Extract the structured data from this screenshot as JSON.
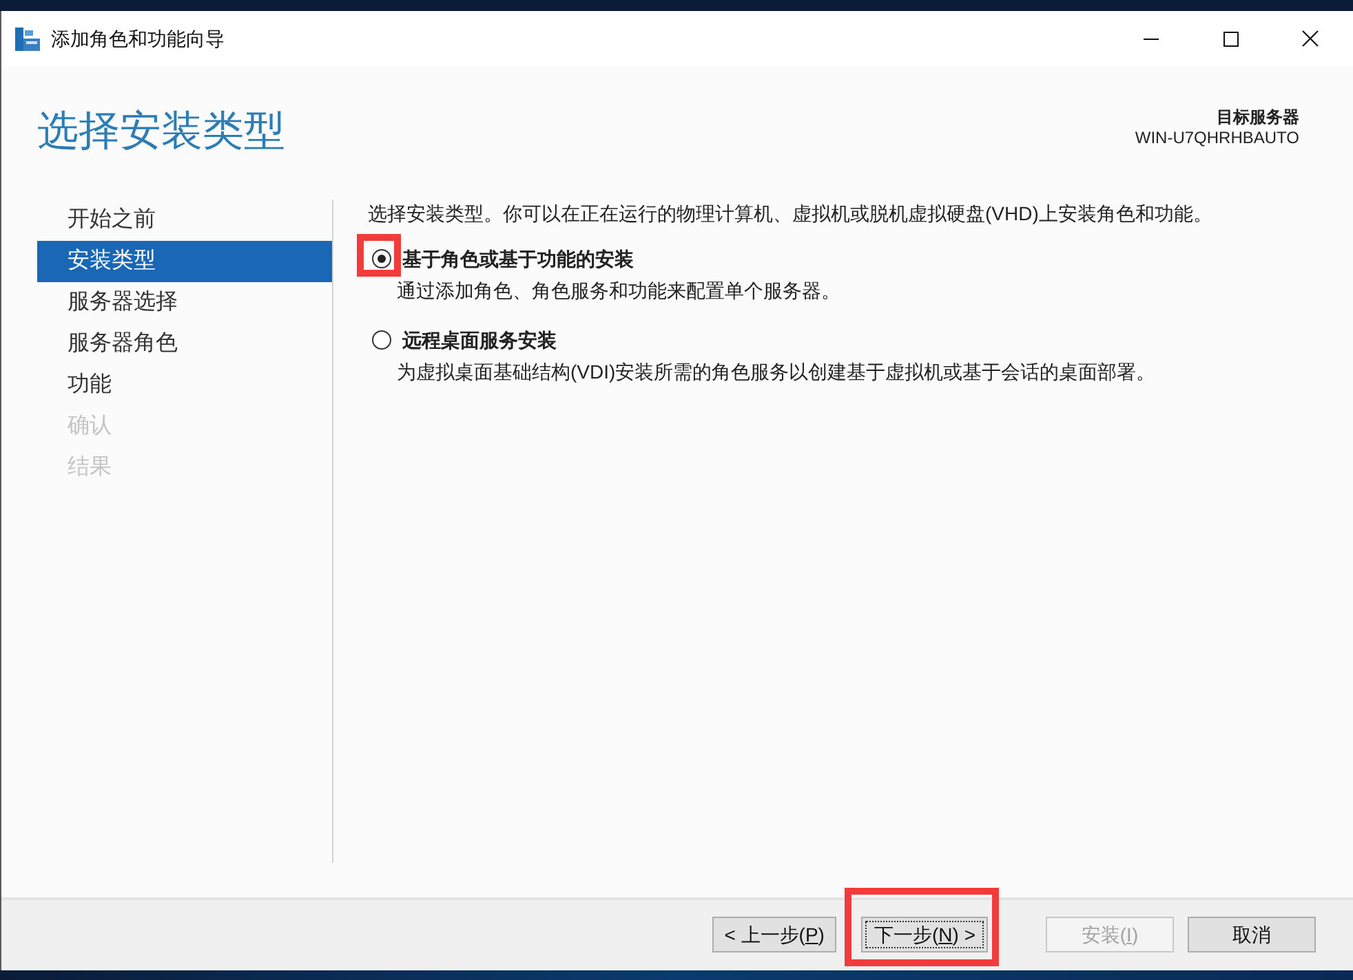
{
  "window": {
    "title": "添加角色和功能向导"
  },
  "header": {
    "title": "选择安装类型",
    "target_label": "目标服务器",
    "target_server": "WIN-U7QHRHBAUTO"
  },
  "sidebar": {
    "items": [
      {
        "label": "开始之前",
        "selected": false,
        "disabled": false
      },
      {
        "label": "安装类型",
        "selected": true,
        "disabled": false
      },
      {
        "label": "服务器选择",
        "selected": false,
        "disabled": false
      },
      {
        "label": "服务器角色",
        "selected": false,
        "disabled": false
      },
      {
        "label": "功能",
        "selected": false,
        "disabled": false
      },
      {
        "label": "确认",
        "selected": false,
        "disabled": true
      },
      {
        "label": "结果",
        "selected": false,
        "disabled": true
      }
    ]
  },
  "content": {
    "intro": "选择安装类型。你可以在正在运行的物理计算机、虚拟机或脱机虚拟硬盘(VHD)上安装角色和功能。",
    "options": [
      {
        "label": "基于角色或基于功能的安装",
        "description": "通过添加角色、角色服务和功能来配置单个服务器。",
        "selected": true,
        "highlighted": true
      },
      {
        "label": "远程桌面服务安装",
        "description": "为虚拟桌面基础结构(VDI)安装所需的角色服务以创建基于虚拟机或基于会话的桌面部署。",
        "selected": false,
        "highlighted": false
      }
    ]
  },
  "buttons": [
    {
      "label": "< 上一步(",
      "access_key": "P",
      "suffix": ")",
      "disabled": false,
      "focused": false,
      "highlighted": false
    },
    {
      "label": "下一步(",
      "access_key": "N",
      "suffix": ") >",
      "disabled": false,
      "focused": true,
      "highlighted": true
    },
    {
      "label": "安装(",
      "access_key": "I",
      "suffix": ")",
      "disabled": true,
      "focused": false,
      "highlighted": false
    },
    {
      "label": "取消",
      "disabled": false,
      "focused": false,
      "highlighted": false
    }
  ]
}
